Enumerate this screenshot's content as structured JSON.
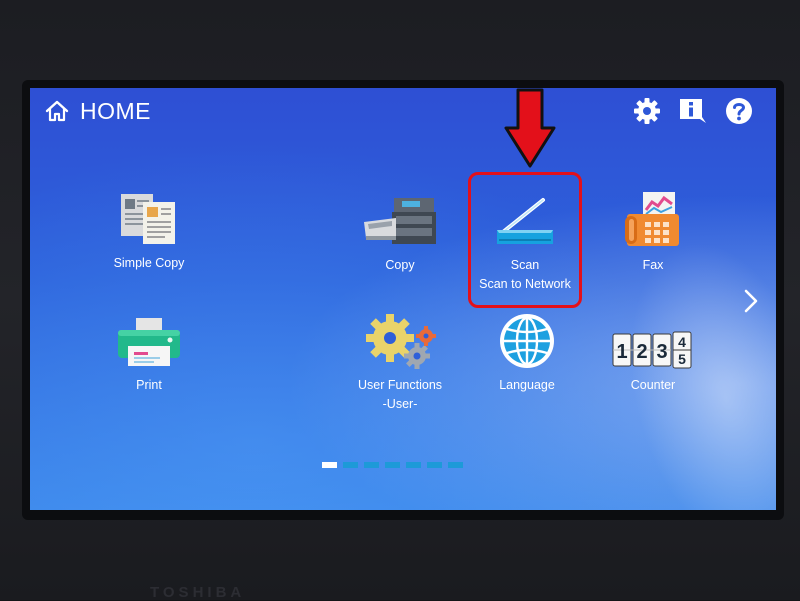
{
  "header": {
    "title": "HOME",
    "icons": [
      "home-icon",
      "settings-gear-icon",
      "information-icon",
      "help-icon"
    ]
  },
  "tiles": [
    {
      "id": "simple-copy",
      "label": "Simple Copy",
      "sublabel": "",
      "icon": "simple-copy-icon"
    },
    {
      "id": "copy",
      "label": "Copy",
      "sublabel": "",
      "icon": "copier-icon"
    },
    {
      "id": "scan",
      "label": "Scan",
      "sublabel": "Scan to Network",
      "icon": "scanner-icon"
    },
    {
      "id": "fax",
      "label": "Fax",
      "sublabel": "",
      "icon": "fax-icon"
    },
    {
      "id": "print",
      "label": "Print",
      "sublabel": "",
      "icon": "printer-icon"
    },
    {
      "id": "user-functions",
      "label": "User Functions",
      "sublabel": "-User-",
      "icon": "gears-icon"
    },
    {
      "id": "language",
      "label": "Language",
      "sublabel": "",
      "icon": "globe-icon"
    },
    {
      "id": "counter",
      "label": "Counter",
      "sublabel": "",
      "icon": "counter-icon"
    }
  ],
  "counter_digits": [
    "1",
    "2",
    "3",
    "4",
    "5"
  ],
  "pagination": {
    "pages": 7,
    "current": 1
  },
  "annotation": {
    "target": "scan",
    "color": "#e3101a"
  },
  "device_brand": "TOSHIBA",
  "colors": {
    "screen_top": "#2e4fd4",
    "screen_bottom": "#3b86ea",
    "highlight": "#e3101a",
    "pager_dot": "#1d9ad8"
  }
}
